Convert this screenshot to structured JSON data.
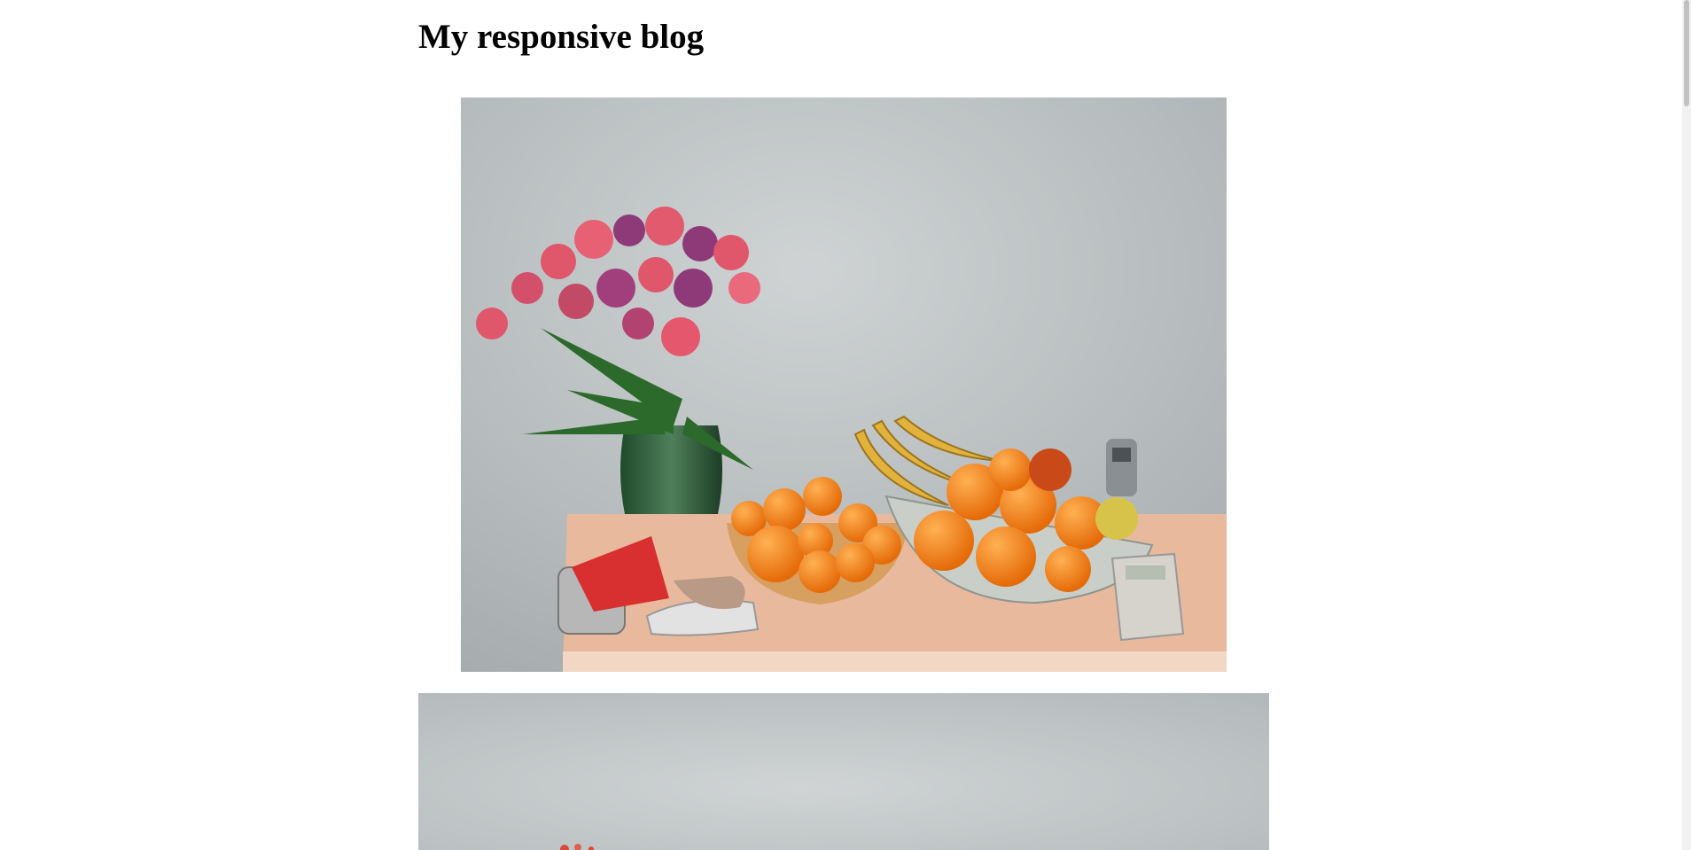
{
  "blog": {
    "title": "My responsive blog"
  },
  "images": [
    {
      "name": "still-life-photo"
    },
    {
      "name": "still-life-photo-large"
    }
  ],
  "colors": {
    "background": "#ffffff",
    "wall": "#b9bec0",
    "cabinet": "#e6b597",
    "orange": "#f07a16",
    "banana": "#e2b23c",
    "flower_pink": "#e0566a",
    "flower_purple": "#8e3a78",
    "leaf": "#2b6a2a",
    "vase": "#2f5a3a"
  }
}
